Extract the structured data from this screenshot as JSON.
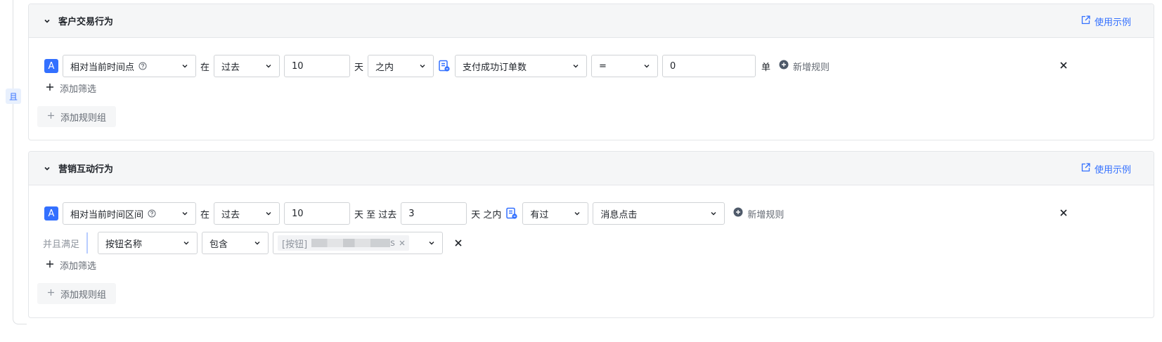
{
  "logic": {
    "label": "且"
  },
  "groups": [
    {
      "title": "客户交易行为",
      "example_link": "使用示例",
      "rule": {
        "badge": "A",
        "time_type": "相对当前时间点",
        "prefix": "在",
        "period": "过去",
        "number": "10",
        "unit": "天",
        "range": "之内",
        "metric": "支付成功订单数",
        "operator": "=",
        "value": "0",
        "value_unit": "单",
        "add_rule": "新增规则"
      },
      "add_filter": "添加筛选",
      "add_group": "添加规则组"
    },
    {
      "title": "营销互动行为",
      "example_link": "使用示例",
      "rule": {
        "badge": "A",
        "time_type": "相对当前时间区间",
        "prefix": "在",
        "period": "过去",
        "number_from": "10",
        "unit_to": "天 至 过去",
        "number_to": "3",
        "range": "天 之内",
        "behavior": "有过",
        "event": "消息点击",
        "add_rule": "新增规则"
      },
      "sub_condition": {
        "label": "并且满足",
        "field": "按钮名称",
        "operator": "包含",
        "tag_prefix": "[按钮]",
        "tag_suffix": "s"
      },
      "add_filter": "添加筛选",
      "add_group": "添加规则组"
    }
  ],
  "icons": {
    "chevron": "chevron-down-icon",
    "external": "external-link-icon",
    "help": "question-circle-icon",
    "doc": "document-tag-icon",
    "plus_circle": "plus-circle-icon",
    "plus": "plus-icon",
    "close": "close-icon"
  },
  "colors": {
    "accent": "#3370ff",
    "header_bg": "#f5f6f7",
    "border": "#d0d3d6"
  }
}
